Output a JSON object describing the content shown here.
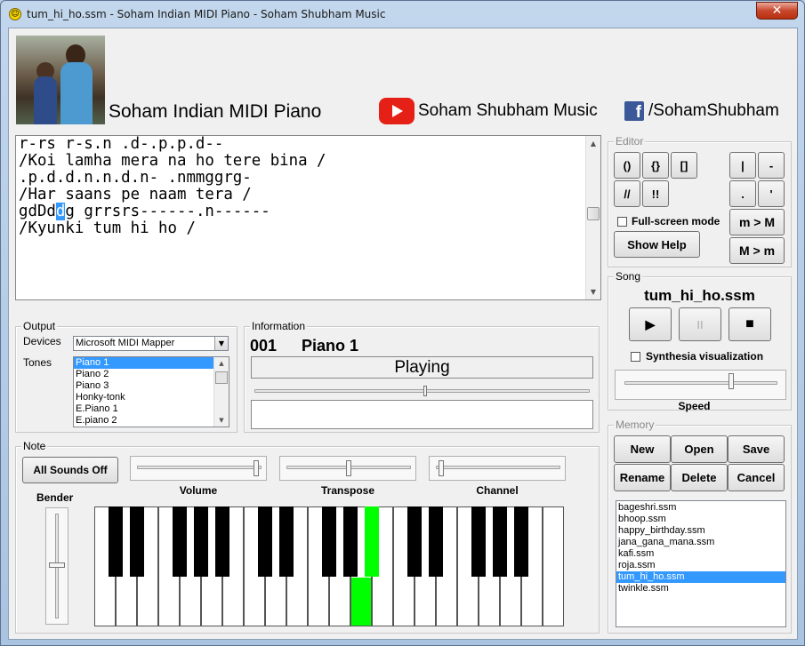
{
  "window": {
    "title": "tum_hi_ho.ssm - Soham Indian MIDI Piano - Soham Shubham Music",
    "close": "✕"
  },
  "header": {
    "app_name": "Soham Indian MIDI Piano",
    "youtube": "Soham Shubham Music",
    "facebook": "/SohamShubham",
    "fb_glyph": "f"
  },
  "editor_lines": [
    "r-rs r-s.n .d-.p.p.d--",
    "",
    "/Koi lamha mera na ho tere bina /",
    ".p.d.d.n.n.d.n- .nmmggrg-",
    "",
    "/Har saans pe naam tera /",
    "",
    "",
    "/Kyunki tum hi ho /"
  ],
  "editor_sel": {
    "before": "gdDd",
    "selected": "d",
    "after": "g grrsrs------.n------"
  },
  "editor_group": {
    "label": "Editor",
    "buttons": [
      "()",
      "{}",
      "[]",
      "//",
      "!!",
      "|",
      "-",
      ".",
      "'"
    ],
    "fullscreen": "Full-screen mode",
    "show_help": "Show Help",
    "m_to_M": "m > M",
    "M_to_m": "M > m"
  },
  "song": {
    "label": "Song",
    "name": "tum_hi_ho.ssm",
    "play": "▶",
    "pause": "II",
    "stop": "■",
    "synthesia": "Synthesia visualization",
    "speed": "Speed"
  },
  "memory": {
    "label": "Memory",
    "buttons": [
      "New",
      "Open",
      "Save",
      "Rename",
      "Delete",
      "Cancel"
    ],
    "files": [
      "bageshri.ssm",
      "bhoop.ssm",
      "happy_birthday.ssm",
      "jana_gana_mana.ssm",
      "kafi.ssm",
      "roja.ssm",
      "tum_hi_ho.ssm",
      "twinkle.ssm"
    ],
    "selected": "tum_hi_ho.ssm"
  },
  "output": {
    "label": "Output",
    "devices_label": "Devices",
    "device": "Microsoft MIDI Mapper",
    "tones_label": "Tones",
    "tones": [
      "Piano 1",
      "Piano 2",
      "Piano 3",
      "Honky-tonk",
      "E.Piano 1",
      "E.piano 2"
    ],
    "selected_tone": "Piano 1"
  },
  "information": {
    "label": "Information",
    "number": "001",
    "instrument": "Piano 1",
    "status": "Playing"
  },
  "note": {
    "label": "Note",
    "all_sounds_off": "All Sounds Off",
    "volume": "Volume",
    "transpose": "Transpose",
    "channel": "Channel",
    "bender": "Bender"
  },
  "colors": {
    "highlight": "#3399ff",
    "active_key": "#00ff00"
  }
}
